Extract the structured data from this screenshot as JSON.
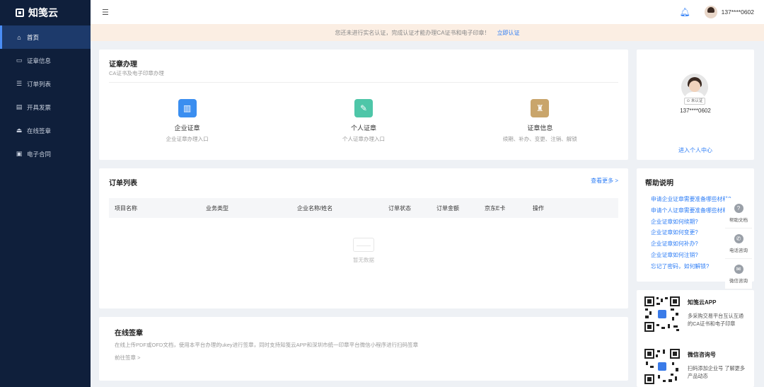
{
  "app": {
    "logo_text": "知笺云"
  },
  "sidebar": {
    "items": [
      {
        "label": "首页",
        "icon": "home-icon",
        "active": true
      },
      {
        "label": "证章信息",
        "icon": "folder-icon",
        "active": false
      },
      {
        "label": "订单列表",
        "icon": "list-icon",
        "active": false
      },
      {
        "label": "开具发票",
        "icon": "invoice-icon",
        "active": false
      },
      {
        "label": "在线签章",
        "icon": "stamp-icon",
        "active": false
      },
      {
        "label": "电子合同",
        "icon": "contract-icon",
        "active": false
      }
    ]
  },
  "header": {
    "user": "137****0602"
  },
  "notice": {
    "text": "您还未进行实名认证，完成认证才能办理CA证书和电子印章！",
    "link": "立即认证"
  },
  "cert": {
    "title": "证章办理",
    "subtitle": "CA证书及电子印章办理",
    "items": [
      {
        "name": "企业证章",
        "desc": "企业证章办理入口"
      },
      {
        "name": "个人证章",
        "desc": "个人证章办理入口"
      },
      {
        "name": "证章信息",
        "desc": "续期、补办、变更、注销、解锁"
      }
    ]
  },
  "profile": {
    "badge": "未认证",
    "name": "137****0602",
    "link": "进入个人中心"
  },
  "orders": {
    "title": "订单列表",
    "view_more": "查看更多 >",
    "columns": [
      "项目名称",
      "业务类型",
      "企业名称/姓名",
      "订单状态",
      "订单金额",
      "京东E卡",
      "操作"
    ],
    "empty_text": "暂无数据"
  },
  "help": {
    "title": "帮助说明",
    "items": [
      "申请企业证章需要准备哪些材料?",
      "申请个人证章需要准备哪些材料?",
      "企业证章如何续期?",
      "企业证章如何变更?",
      "企业证章如何补办?",
      "企业证章如何注销?",
      "忘记了密码，如何解锁?"
    ]
  },
  "float": {
    "items": [
      {
        "label": "帮助文档",
        "glyph": "?"
      },
      {
        "label": "电话咨询",
        "glyph": "✆"
      },
      {
        "label": "微信咨询",
        "glyph": "✉"
      }
    ]
  },
  "sign": {
    "title": "在线签章",
    "desc": "在线上传PDF或OFD文档，使用本平台办理的ukey进行签章，同时支持知笺云APP和深圳市统一印章平台微信小程序进行扫码签章",
    "link": "前往签章 >"
  },
  "qr": {
    "items": [
      {
        "title": "知笺云APP",
        "desc": "多采购交易平台互认互通的CA证书和电子印章"
      },
      {
        "title": "微信咨询号",
        "desc": "扫码添加企业号 了解更多产品动态"
      }
    ]
  }
}
